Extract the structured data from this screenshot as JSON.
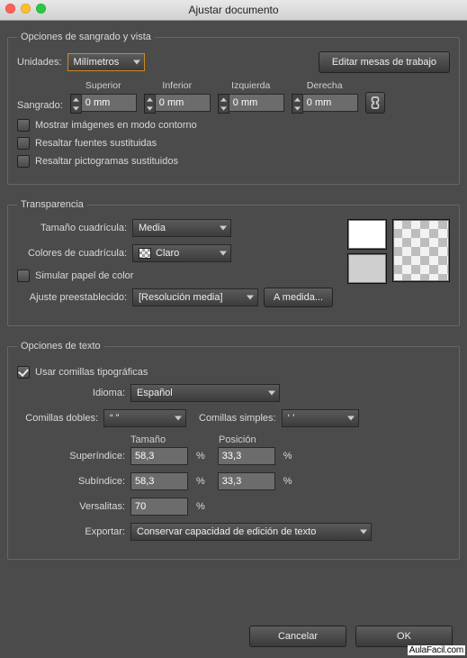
{
  "title": "Ajustar documento",
  "group_bleed": {
    "legend": "Opciones de sangrado y vista",
    "units_label": "Unidades:",
    "units_value": "Milímetros",
    "edit_artboards_btn": "Editar mesas de trabajo",
    "bleed_label": "Sangrado:",
    "cols": {
      "top": "Superior",
      "bottom": "Inferior",
      "left": "Izquierda",
      "right": "Derecha"
    },
    "values": {
      "top": "0 mm",
      "bottom": "0 mm",
      "left": "0 mm",
      "right": "0 mm"
    },
    "chk_outline": "Mostrar imágenes en modo contorno",
    "chk_fonts": "Resaltar fuentes sustituidas",
    "chk_glyphs": "Resaltar pictogramas sustituidos"
  },
  "group_trans": {
    "legend": "Transparencia",
    "grid_size_label": "Tamaño cuadrícula:",
    "grid_size_value": "Media",
    "grid_colors_label": "Colores de cuadrícula:",
    "grid_colors_value": "Claro",
    "simulate_label": "Simular papel de color",
    "preset_label": "Ajuste preestablecido:",
    "preset_value": "[Resolución media]",
    "custom_btn": "A medida..."
  },
  "group_text": {
    "legend": "Opciones de texto",
    "typographers_quotes": "Usar comillas tipográficas",
    "language_label": "Idioma:",
    "language_value": "Español",
    "double_quotes_label": "Comillas dobles:",
    "double_quotes_value": "“ ”",
    "single_quotes_label": "Comillas simples:",
    "single_quotes_value": "‘ ’",
    "size_hdr": "Tamaño",
    "pos_hdr": "Posición",
    "superscript_label": "Superíndice:",
    "superscript_size": "58,3",
    "superscript_pos": "33,3",
    "subscript_label": "Subíndice:",
    "subscript_size": "58,3",
    "subscript_pos": "33,3",
    "smallcaps_label": "Versalitas:",
    "smallcaps_value": "70",
    "export_label": "Exportar:",
    "export_value": "Conservar capacidad de edición de texto",
    "pct": "%"
  },
  "buttons": {
    "cancel": "Cancelar",
    "ok": "OK"
  },
  "watermark": "AulaFacil.com"
}
